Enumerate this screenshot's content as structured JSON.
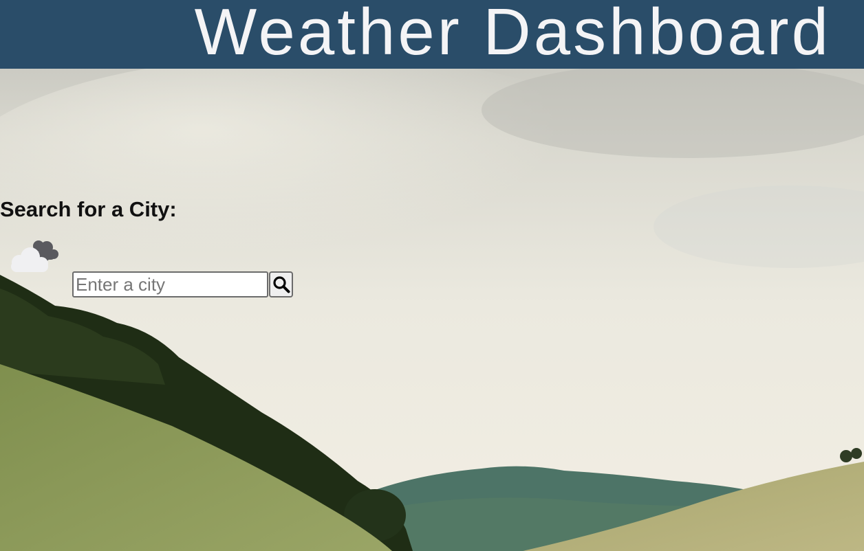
{
  "header": {
    "title": "Weather Dashboard"
  },
  "search": {
    "heading": "Search for a City:",
    "placeholder": "Enter a city",
    "value": "",
    "button_icon": "search-icon"
  },
  "decor": {
    "logo_icon": "cloud-icon",
    "background": "landscape-photo-hills"
  },
  "colors": {
    "header_bg": "#2a4d69",
    "header_text": "#f4f4f6",
    "heading_text": "#111111"
  }
}
